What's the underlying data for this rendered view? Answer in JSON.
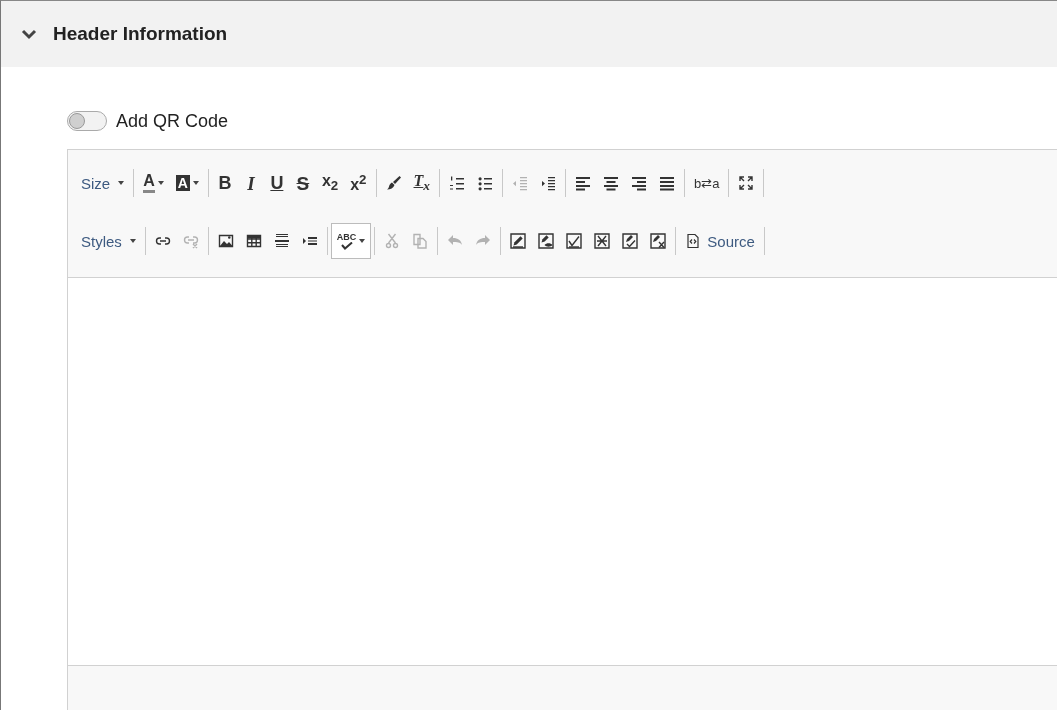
{
  "section": {
    "title": "Header Information",
    "expanded": true
  },
  "qr_toggle": {
    "label": "Add QR Code",
    "on": false
  },
  "editor": {
    "toolbar": [
      [
        [
          {
            "kind": "combo",
            "label": "Size",
            "disabled": false
          }
        ],
        [
          {
            "kind": "textcolor",
            "label": "A",
            "disabled": false
          },
          {
            "kind": "bgcolor",
            "label": "A",
            "disabled": false
          }
        ],
        [
          {
            "kind": "bold",
            "label": "B",
            "disabled": false
          },
          {
            "kind": "italic",
            "label": "I",
            "disabled": false
          },
          {
            "kind": "underline",
            "label": "U",
            "disabled": false
          },
          {
            "kind": "strike",
            "label": "S",
            "disabled": false
          },
          {
            "kind": "subscript",
            "label": "x$_{2}$",
            "disabled": false
          },
          {
            "kind": "superscript",
            "label": "x$^{2}$",
            "disabled": false
          }
        ],
        [
          {
            "kind": "brush",
            "disabled": false
          },
          {
            "kind": "clearformat",
            "label": "T$_{x}$",
            "disabled": false
          }
        ],
        [
          {
            "kind": "numbered",
            "disabled": false
          },
          {
            "kind": "bulleted",
            "disabled": false
          }
        ],
        [
          {
            "kind": "outdent",
            "disabled": true
          },
          {
            "kind": "indent",
            "disabled": false
          }
        ],
        [
          {
            "kind": "alignleft",
            "disabled": false
          },
          {
            "kind": "aligncenter",
            "disabled": false
          },
          {
            "kind": "alignright",
            "disabled": false
          },
          {
            "kind": "justify",
            "disabled": false
          }
        ],
        [
          {
            "kind": "bidi",
            "label": "b⇄a",
            "disabled": false
          }
        ],
        [
          {
            "kind": "maximize",
            "disabled": false
          }
        ]
      ],
      [
        [
          {
            "kind": "combo",
            "label": "Styles",
            "disabled": false
          }
        ],
        [
          {
            "kind": "link",
            "disabled": false
          },
          {
            "kind": "unlink",
            "disabled": true
          }
        ],
        [
          {
            "kind": "image",
            "disabled": false
          },
          {
            "kind": "table",
            "disabled": false
          },
          {
            "kind": "rule",
            "disabled": false
          },
          {
            "kind": "blockquote",
            "disabled": false
          }
        ],
        [
          {
            "kind": "spellcheck",
            "label": "ABC",
            "disabled": false
          }
        ],
        [
          {
            "kind": "cut",
            "disabled": true
          },
          {
            "kind": "copy",
            "disabled": true
          }
        ],
        [
          {
            "kind": "undo",
            "disabled": true
          },
          {
            "kind": "redo",
            "disabled": true
          }
        ],
        [
          {
            "kind": "trackpencil",
            "disabled": false
          },
          {
            "kind": "trackeye",
            "disabled": false
          },
          {
            "kind": "trackcheck",
            "disabled": false
          },
          {
            "kind": "trackcross",
            "disabled": false
          },
          {
            "kind": "trackpencilcheck",
            "disabled": false
          },
          {
            "kind": "trackpencilcross",
            "disabled": false
          }
        ],
        [
          {
            "kind": "source",
            "label": "Source",
            "disabled": false
          }
        ]
      ]
    ]
  }
}
